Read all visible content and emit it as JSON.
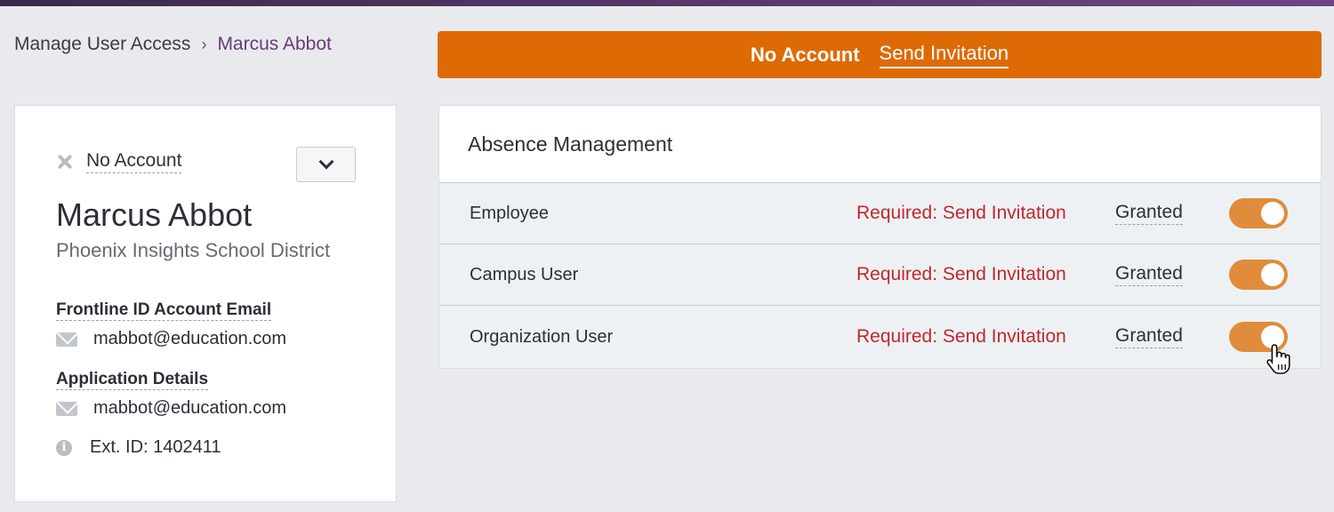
{
  "breadcrumb": {
    "root": "Manage User Access",
    "separator": "›",
    "current": "Marcus Abbot"
  },
  "alert": {
    "status": "No Account",
    "action": "Send Invitation",
    "color": "#de6a05"
  },
  "user": {
    "account_status": "No Account",
    "name": "Marcus Abbot",
    "organization": "Phoenix Insights School District",
    "email_label": "Frontline ID Account Email",
    "email": "mabbot@education.com",
    "app_details_label": "Application Details",
    "app_email": "mabbot@education.com",
    "ext_id": "Ext. ID: 1402411"
  },
  "permissions": {
    "title": "Absence Management",
    "rows": [
      {
        "name": "Employee",
        "required": "Required: Send Invitation",
        "status": "Granted",
        "enabled": true
      },
      {
        "name": "Campus User",
        "required": "Required: Send Invitation",
        "status": "Granted",
        "enabled": true
      },
      {
        "name": "Organization User",
        "required": "Required: Send Invitation",
        "status": "Granted",
        "enabled": true
      }
    ]
  },
  "icons": {
    "account_status": "close-icon",
    "dropdown": "chevron-down-icon",
    "email": "mail-icon",
    "ext_id": "info-icon",
    "pointer": "hand-cursor-icon"
  }
}
